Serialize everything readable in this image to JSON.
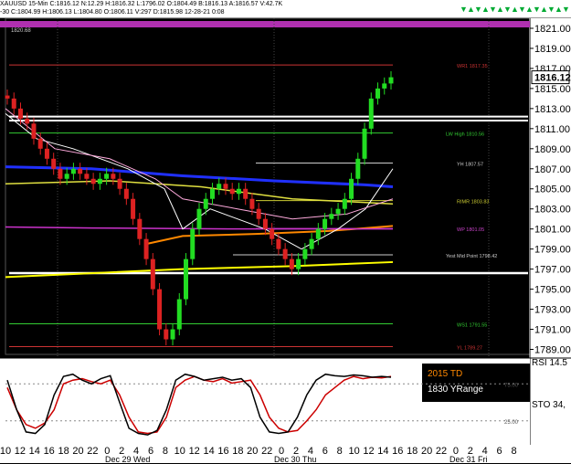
{
  "header": {
    "symbol_line": "XAUUSD  15-Min  C:1816.12  N:12.29  H:1816.32  L:1796.02  O:1804.49  B:1816.13  A:1816.57  V:42.7K",
    "sub_line": "-30  C:1804.99  H:1806.13  L:1804.80  O:1806.11  V:297  D:1815.98  12-28-21  0:08"
  },
  "toolbar_icons": [
    "green-arrow-icon",
    "green-arrow-icon",
    "green-arrow-icon",
    "green-arrow-icon",
    "green-arrow-icon",
    "green-arrow-icon",
    "green-arrow-icon",
    "green-arrow-icon",
    "green-arrow-icon",
    "green-arrow-icon",
    "green-arrow-icon",
    "green-arrow-icon",
    "green-arrow-icon",
    "green-arrow-icon",
    "green-arrow-icon"
  ],
  "price_axis": {
    "labels": [
      "1821.00",
      "1819.00",
      "1817.00",
      "1815.00",
      "1813.00",
      "1811.00",
      "1809.00",
      "1807.00",
      "1805.00",
      "1803.00",
      "1801.00",
      "1799.00",
      "1797.00",
      "1795.00",
      "1793.00",
      "1791.00",
      "1789.00"
    ],
    "current_price": "1816.12",
    "top_left_label": "1820.68"
  },
  "levels": [
    {
      "label": "WR1  1817.35",
      "price": 1817.35,
      "color": "#cc3333"
    },
    {
      "label": "LW High  1810.56",
      "price": 1810.56,
      "color": "#33cc33"
    },
    {
      "label": "YH  1807.57",
      "price": 1807.57,
      "color": "#cccccc"
    },
    {
      "label": "RIMR  1803.83",
      "price": 1803.83,
      "color": "#cccc33"
    },
    {
      "label": "WP  1801.05",
      "price": 1801.05,
      "color": "#cc44cc"
    },
    {
      "label": "Yest Mid Point  1798.42",
      "price": 1798.42,
      "color": "#cccccc"
    },
    {
      "label": "WS1  1791.55",
      "price": 1791.55,
      "color": "#33cc33"
    },
    {
      "label": "YL  1789.27",
      "price": 1789.27,
      "color": "#cc3333"
    }
  ],
  "indicators": {
    "rsi_label": "RSI  14.5",
    "sto_label": "STO  34,",
    "lower_text_1": "2015 TD",
    "lower_text_2": "1830 YRange",
    "sto_ticks": [
      "25.00",
      "75.00"
    ]
  },
  "time_axis": {
    "hours": [
      "10",
      "12",
      "14",
      "16",
      "18",
      "20",
      "22",
      "0",
      "2",
      "4",
      "6",
      "8",
      "10",
      "12",
      "14",
      "16",
      "18",
      "20",
      "22",
      "0",
      "2",
      "4",
      "6",
      "8",
      "10",
      "12",
      "14",
      "16",
      "18",
      "20",
      "22",
      "0",
      "2",
      "4",
      "6",
      "8"
    ],
    "dates": [
      "Dec 29 Wed",
      "Dec 30 Thu",
      "Dec 31 Fri"
    ]
  },
  "chart_data": {
    "type": "candlestick",
    "symbol": "XAUUSD",
    "interval": "15-Min",
    "ylim": [
      1788.5,
      1822
    ],
    "closes": [
      1814,
      1813,
      1812,
      1811.5,
      1810,
      1809,
      1808,
      1807,
      1806,
      1806.5,
      1807,
      1806.5,
      1806,
      1805.5,
      1806,
      1806.5,
      1806,
      1805,
      1804,
      1802,
      1800,
      1798,
      1795,
      1791,
      1790,
      1791,
      1794,
      1798,
      1801,
      1803,
      1804,
      1805,
      1805.5,
      1805,
      1804.5,
      1805,
      1804,
      1803,
      1802,
      1801,
      1800,
      1799,
      1798,
      1797,
      1798,
      1799,
      1800,
      1801,
      1802,
      1802.5,
      1803,
      1804,
      1806,
      1808,
      1811,
      1814,
      1815,
      1815.5,
      1816.12
    ],
    "rsi_values": [
      70,
      40,
      20,
      15,
      22,
      40,
      75,
      80,
      82,
      78,
      75,
      80,
      60,
      30,
      10,
      8,
      10,
      30,
      70,
      80,
      85,
      80,
      78,
      82,
      76,
      78,
      80,
      60,
      30,
      15,
      10,
      12,
      25,
      40,
      60,
      70,
      80,
      85,
      82,
      84,
      83,
      85
    ],
    "sto_values": [
      80,
      40,
      10,
      8,
      20,
      60,
      85,
      88,
      80,
      75,
      82,
      86,
      50,
      15,
      8,
      6,
      12,
      40,
      80,
      88,
      85,
      80,
      82,
      84,
      80,
      82,
      70,
      30,
      10,
      8,
      10,
      30,
      60,
      80,
      88,
      86,
      85,
      87,
      86,
      84,
      85,
      84
    ]
  }
}
